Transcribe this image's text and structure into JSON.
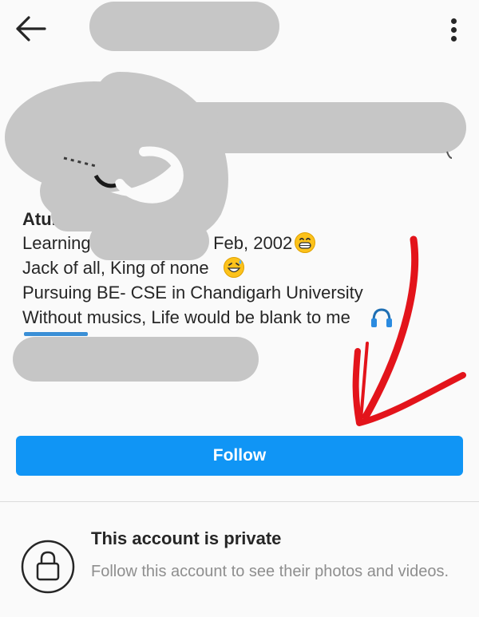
{
  "profile": {
    "name_visible": "Atul",
    "bio_lines": [
      {
        "before": "Learning ",
        "after": "ce Feb, 2002"
      },
      {
        "text": "Jack of all, King of none"
      },
      {
        "text": "Pursuing BE- CSE in Chandigarh University"
      },
      {
        "text": "Without musics, Life would be blank to me"
      }
    ],
    "emojis": [
      "grinning-face-icon",
      "grin-sweat-icon",
      "headphone-icon"
    ]
  },
  "actions": {
    "follow_label": "Follow"
  },
  "private_notice": {
    "title": "This account is private",
    "subtitle": "Follow this account to see their photos and videos."
  },
  "colors": {
    "accent": "#1095f5",
    "background": "#fafafa",
    "text": "#262626",
    "muted": "#8e8e8e",
    "redaction": "#c6c6c6",
    "annotation_arrow": "#e3141b"
  }
}
